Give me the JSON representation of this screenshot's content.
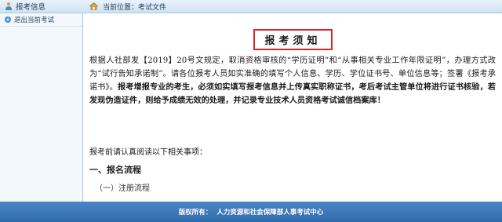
{
  "topbar": {
    "left_title": "报考信息",
    "breadcrumb_label": "当前位置：",
    "breadcrumb_value": "考试文件"
  },
  "sidebar": {
    "items": [
      {
        "label": "退出当前考试"
      }
    ]
  },
  "main": {
    "notice_title": "报考须知",
    "paragraph": {
      "part1": "根据人社部发【2019】20号文规定，取消资格审核的“学历证明”和“从事相关专业工作年限证明”，办理方式改为“试行告知承诺制”。请各位报考人员如实准确的填写个人信息、学历、学位证书号、单位信息等；签署《报考承诺书》。",
      "part2": "报考增报专业的考生，必须如实填写报考信息并上传真实职称证书，考后考试主管单位将进行证书核验，若发现伪造证件，则给予成绩无效的处理，并记录专业技术人员资格考试诚信档案库！"
    },
    "read_note": "报考前请认真阅读以下相关事项：",
    "section_1": "一、报名流程",
    "subsection_1": "（一）注册流程"
  },
  "footer": {
    "copyright_label": "版权所有：",
    "copyright_value": "人力资源和社会保障部人事考试中心"
  }
}
